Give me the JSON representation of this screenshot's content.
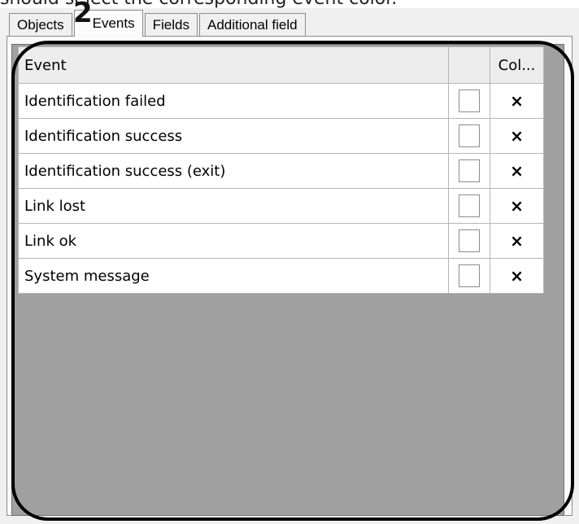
{
  "caption": "should select the corresponding event color.",
  "tabs": [
    "Objects",
    "Events",
    "Fields",
    "Additional field"
  ],
  "badge": "2",
  "table": {
    "headers": [
      "Event",
      "",
      "Col..."
    ],
    "rows": [
      {
        "event": "Identification failed",
        "checked": false,
        "color": "×"
      },
      {
        "event": "Identification success",
        "checked": false,
        "color": "×"
      },
      {
        "event": "Identification success (exit)",
        "checked": false,
        "color": "×"
      },
      {
        "event": "Link lost",
        "checked": false,
        "color": "×"
      },
      {
        "event": "Link ok",
        "checked": false,
        "color": "×"
      },
      {
        "event": "System message",
        "checked": false,
        "color": "×"
      }
    ]
  }
}
